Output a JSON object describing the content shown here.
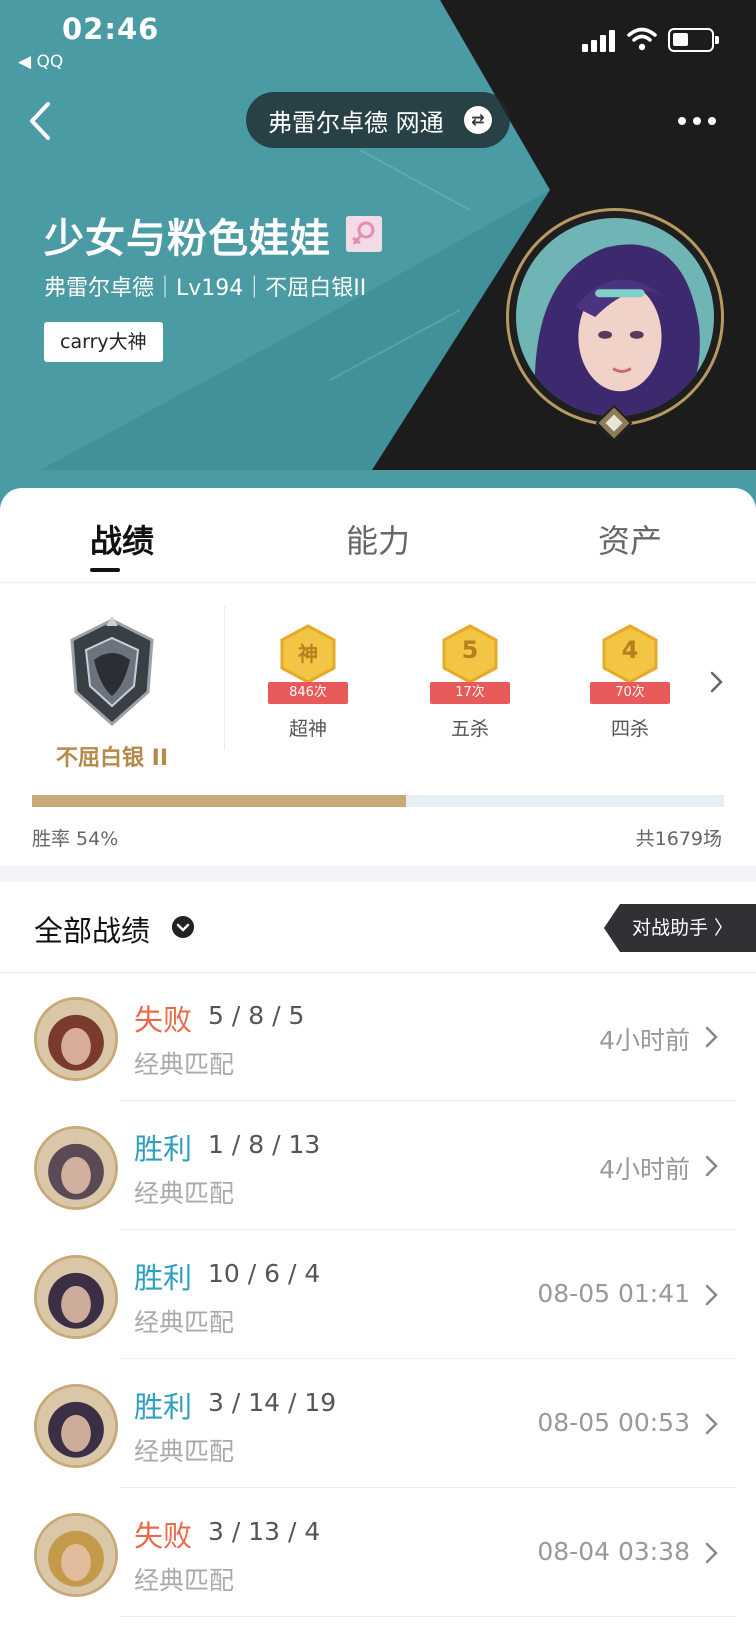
{
  "status_bar": {
    "time": "02:46",
    "back_app": "◀ QQ"
  },
  "header": {
    "server": "弗雷尔卓德 网通",
    "player_name": "少女与粉色娃娃",
    "meta": "弗雷尔卓德｜Lv194｜不屈白银II",
    "tag": "carry大神"
  },
  "tabs": [
    {
      "label": "战绩",
      "active": true
    },
    {
      "label": "能力",
      "active": false
    },
    {
      "label": "资产",
      "active": false
    }
  ],
  "rank": {
    "name": "不屈白银 II"
  },
  "badges": [
    {
      "glyph": "神",
      "count": "846次",
      "label": "超神"
    },
    {
      "glyph": "5",
      "count": "17次",
      "label": "五杀"
    },
    {
      "glyph": "4",
      "count": "70次",
      "label": "四杀"
    }
  ],
  "stats": {
    "win_rate_text": "胜率 54%",
    "win_rate_value": 0.54,
    "total_text": "共1679场"
  },
  "history": {
    "title": "全部战绩",
    "assistant": "对战助手 〉",
    "matches": [
      {
        "result": "失败",
        "outcome": "lose",
        "kda": "5 / 8 / 5",
        "mode": "经典匹配",
        "time": "4小时前",
        "avatar_color": "#7a3b2e"
      },
      {
        "result": "胜利",
        "outcome": "win",
        "kda": "1 / 8 / 13",
        "mode": "经典匹配",
        "time": "4小时前",
        "avatar_color": "#5a4a56"
      },
      {
        "result": "胜利",
        "outcome": "win",
        "kda": "10 / 6 / 4",
        "mode": "经典匹配",
        "time": "08-05 01:41",
        "avatar_color": "#3b2f45"
      },
      {
        "result": "胜利",
        "outcome": "win",
        "kda": "3 / 14 / 19",
        "mode": "经典匹配",
        "time": "08-05 00:53",
        "avatar_color": "#3b2f45"
      },
      {
        "result": "失败",
        "outcome": "lose",
        "kda": "3 / 13 / 4",
        "mode": "经典匹配",
        "time": "08-04 03:38",
        "avatar_color": "#c29a4a"
      }
    ]
  },
  "colors": {
    "hero_teal": "#4a9ba3",
    "lose": "#e86a49",
    "win": "#2d9fc1",
    "gold": "#c9a977"
  }
}
